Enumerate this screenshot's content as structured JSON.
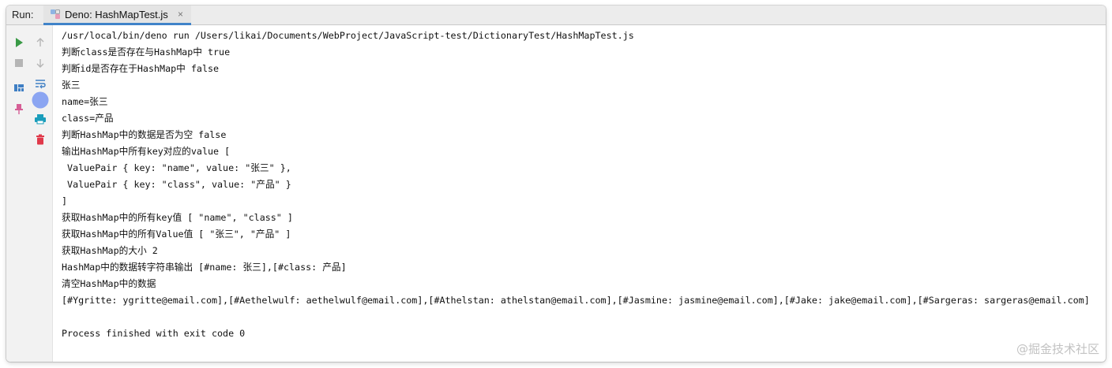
{
  "panel": {
    "run_label": "Run:",
    "tab": {
      "title": "Deno: HashMapTest.js",
      "close_glyph": "×",
      "icon": "deno-config-icon"
    },
    "accent_color": "#4083c9"
  },
  "toolbar": {
    "buttons": [
      {
        "name": "rerun-icon",
        "color": "#3a9a46"
      },
      {
        "name": "stop-icon",
        "color": "#b5b5b5"
      },
      {
        "name": "up-arrow-icon",
        "color": "#b5b5b5"
      },
      {
        "name": "down-arrow-icon",
        "color": "#b5b5b5"
      },
      {
        "name": "layout-icon",
        "color": "#3f7fc4"
      },
      {
        "name": "soft-wrap-icon",
        "color": "#3f7fc4"
      },
      {
        "name": "scroll-to-end-icon",
        "color": "#8ba5f2"
      },
      {
        "name": "pin-icon",
        "color": "#d65f96"
      },
      {
        "name": "print-icon",
        "color": "#1a9dbb"
      },
      {
        "name": "trash-icon",
        "color": "#e0394a"
      }
    ]
  },
  "console": {
    "lines": [
      "/usr/local/bin/deno run /Users/likai/Documents/WebProject/JavaScript-test/DictionaryTest/HashMapTest.js",
      "判断class是否存在与HashMap中 true",
      "判断id是否存在于HashMap中 false",
      "张三",
      "name=张三",
      "class=产品",
      "判断HashMap中的数据是否为空 false",
      "输出HashMap中所有key对应的value [",
      " ValuePair { key: \"name\", value: \"张三\" },",
      " ValuePair { key: \"class\", value: \"产品\" }",
      "]",
      "获取HashMap中的所有key值 [ \"name\", \"class\" ]",
      "获取HashMap中的所有Value值 [ \"张三\", \"产品\" ]",
      "获取HashMap的大小 2",
      "HashMap中的数据转字符串输出 [#name: 张三],[#class: 产品]",
      "清空HashMap中的数据",
      "[#Ygritte: ygritte@email.com],[#Aethelwulf: aethelwulf@email.com],[#Athelstan: athelstan@email.com],[#Jasmine: jasmine@email.com],[#Jake: jake@email.com],[#Sargeras: sargeras@email.com]",
      "",
      "Process finished with exit code 0"
    ]
  },
  "watermark": "@掘金技术社区"
}
